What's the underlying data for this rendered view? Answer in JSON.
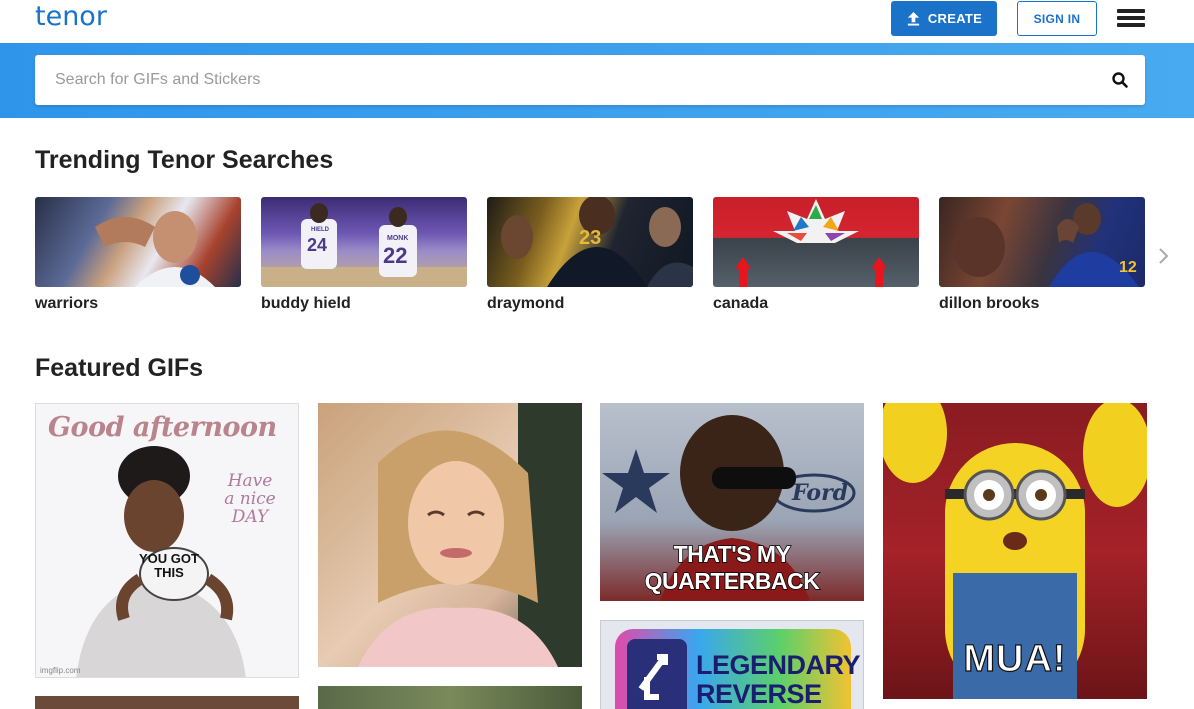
{
  "header": {
    "logo": "tenor",
    "create_label": "CREATE",
    "signin_label": "SIGN IN"
  },
  "search": {
    "placeholder": "Search for GIFs and Stickers"
  },
  "trending": {
    "title": "Trending Tenor Searches",
    "items": [
      {
        "label": "warriors"
      },
      {
        "label": "buddy hield"
      },
      {
        "label": "draymond"
      },
      {
        "label": "canada"
      },
      {
        "label": "dillon brooks"
      }
    ],
    "jersey_numbers": [
      "24",
      "22",
      "23",
      "12"
    ],
    "jersey_names": [
      "HIELD",
      "MONK"
    ]
  },
  "featured": {
    "title": "Featured GIFs",
    "gifs": [
      {
        "text": "Good afternoon",
        "side_text": "Have a nice DAY",
        "mug_text": "YOU GOT THIS",
        "watermark": "imgflip.com"
      },
      {
        "text": ""
      },
      {
        "text": "THAT'S MY QUARTERBACK",
        "sign_text": "Ford"
      },
      {
        "text": "LEGENDARY REVERSE CARD"
      },
      {
        "text": "MUA!"
      }
    ]
  },
  "colors": {
    "brand": "#1a73c8",
    "search_band": "#3fa3ee"
  }
}
